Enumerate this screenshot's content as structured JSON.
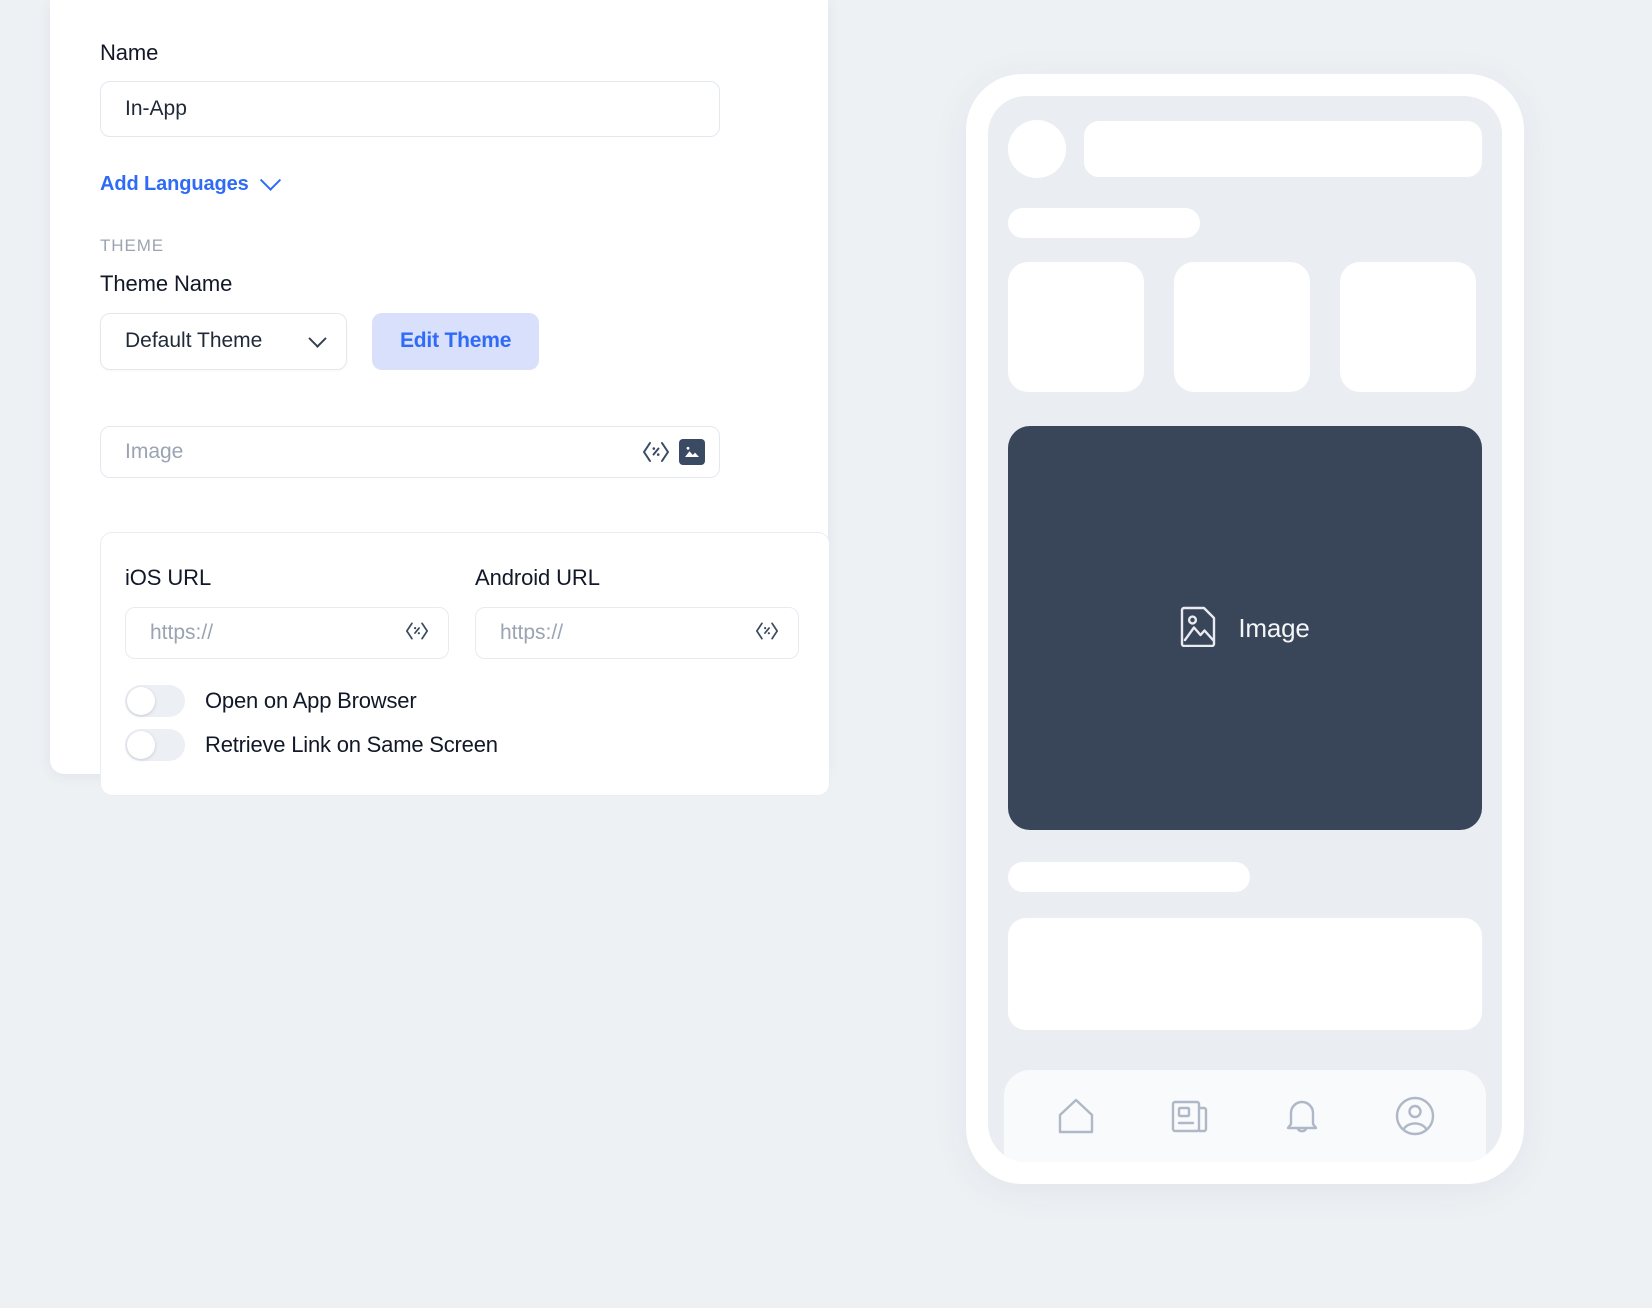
{
  "form": {
    "name_label": "Name",
    "name_value": "In-App",
    "add_languages_label": "Add Languages",
    "add_languages_icon": "chevron-down-icon",
    "theme_section_heading": "THEME",
    "theme_name_label": "Theme Name",
    "theme_selected": "Default Theme",
    "theme_select_icon": "chevron-down-icon",
    "edit_theme_label": "Edit Theme",
    "image_placeholder": "Image",
    "image_code_icon": "code-brackets-icon",
    "image_picker_icon": "image-icon",
    "url_card": {
      "ios_label": "iOS URL",
      "ios_placeholder": "https://",
      "ios_code_icon": "code-brackets-icon",
      "android_label": "Android URL",
      "android_placeholder": "https://",
      "android_code_icon": "code-brackets-icon",
      "toggles": [
        {
          "label": "Open on App Browser",
          "on": false
        },
        {
          "label": "Retrieve Link on Same Screen",
          "on": false
        }
      ]
    }
  },
  "preview": {
    "image_card_label": "Image",
    "image_card_icon": "image-placeholder-icon",
    "nav_items": [
      {
        "icon": "home-icon"
      },
      {
        "icon": "news-icon"
      },
      {
        "icon": "bell-icon"
      },
      {
        "icon": "account-circle-icon"
      }
    ]
  },
  "colors": {
    "page_background": "#eef1f4",
    "accent_blue": "#2f6bf6",
    "edit_theme_background": "#d8e0fb",
    "dark_card": "#394559",
    "muted_text": "#9aa4b2",
    "phone_screen": "#eaeef2"
  }
}
